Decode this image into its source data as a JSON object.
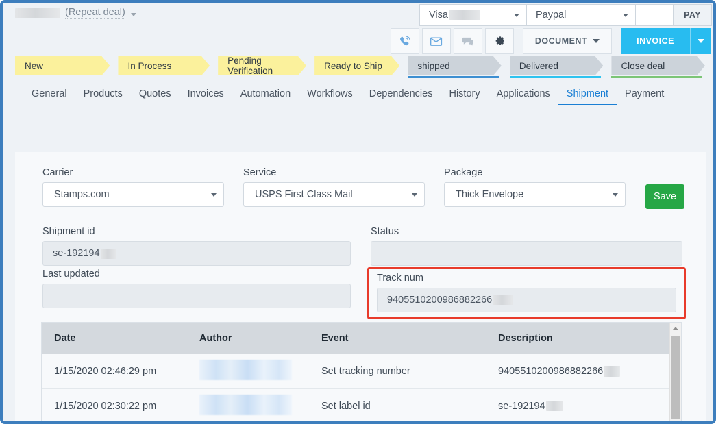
{
  "header": {
    "deal_name_redacted": "",
    "deal_type": "(Repeat deal)",
    "payment": {
      "card_label": "Visa",
      "card_redacted": "",
      "method_label": "Paypal",
      "blank_label": "",
      "pay_label": "PAY"
    },
    "actions": {
      "call_icon": "phone-icon",
      "email_icon": "envelope-icon",
      "chat_icon": "chat-bubble-icon",
      "settings_icon": "gear-icon",
      "document_label": "DOCUMENT",
      "invoice_label": "INVOICE"
    }
  },
  "pipeline": {
    "stages": [
      {
        "label": "New",
        "state": "yellow",
        "underline": ""
      },
      {
        "label": "In Process",
        "state": "yellow",
        "underline": ""
      },
      {
        "label": "Pending Verification",
        "state": "yellow",
        "underline": ""
      },
      {
        "label": "Ready to Ship",
        "state": "yellow",
        "underline": ""
      },
      {
        "label": "shipped",
        "state": "gray",
        "underline": "#3d8fd1"
      },
      {
        "label": "Delivered",
        "state": "gray",
        "underline": "#2ec3ef"
      },
      {
        "label": "Close deal",
        "state": "gray",
        "underline": "#7cc576"
      }
    ]
  },
  "tabs": {
    "items": [
      {
        "label": "General",
        "active": false
      },
      {
        "label": "Products",
        "active": false
      },
      {
        "label": "Quotes",
        "active": false
      },
      {
        "label": "Invoices",
        "active": false
      },
      {
        "label": "Automation",
        "active": false
      },
      {
        "label": "Workflows",
        "active": false
      },
      {
        "label": "Dependencies",
        "active": false
      },
      {
        "label": "History",
        "active": false
      },
      {
        "label": "Applications",
        "active": false
      },
      {
        "label": "Shipment",
        "active": true
      },
      {
        "label": "Payment",
        "active": false
      }
    ]
  },
  "shipment_form": {
    "carrier_label": "Carrier",
    "carrier_value": "Stamps.com",
    "service_label": "Service",
    "service_value": "USPS First Class Mail",
    "package_label": "Package",
    "package_value": "Thick Envelope",
    "save_label": "Save",
    "shipment_id_label": "Shipment id",
    "shipment_id_value": "se-192194",
    "last_updated_label": "Last updated",
    "last_updated_value": "",
    "status_label": "Status",
    "status_value": "",
    "track_num_label": "Track num",
    "track_num_value": "9405510200986882266"
  },
  "history": {
    "columns": [
      "Date",
      "Author",
      "Event",
      "Description"
    ],
    "rows": [
      {
        "date": "1/15/2020 02:46:29 pm",
        "author": "",
        "event": "Set tracking number",
        "description": "9405510200986882266"
      },
      {
        "date": "1/15/2020 02:30:22 pm",
        "author": "",
        "event": "Set label id",
        "description": "se-192194"
      }
    ]
  },
  "colors": {
    "window_border": "#3d7ebd",
    "accent_blue": "#1a7fd4",
    "invoice_cyan": "#28bcf0",
    "save_green": "#26a745",
    "highlight_red": "#e83b2b",
    "stage_yellow": "#fbf19c",
    "stage_gray": "#ccd3da"
  }
}
